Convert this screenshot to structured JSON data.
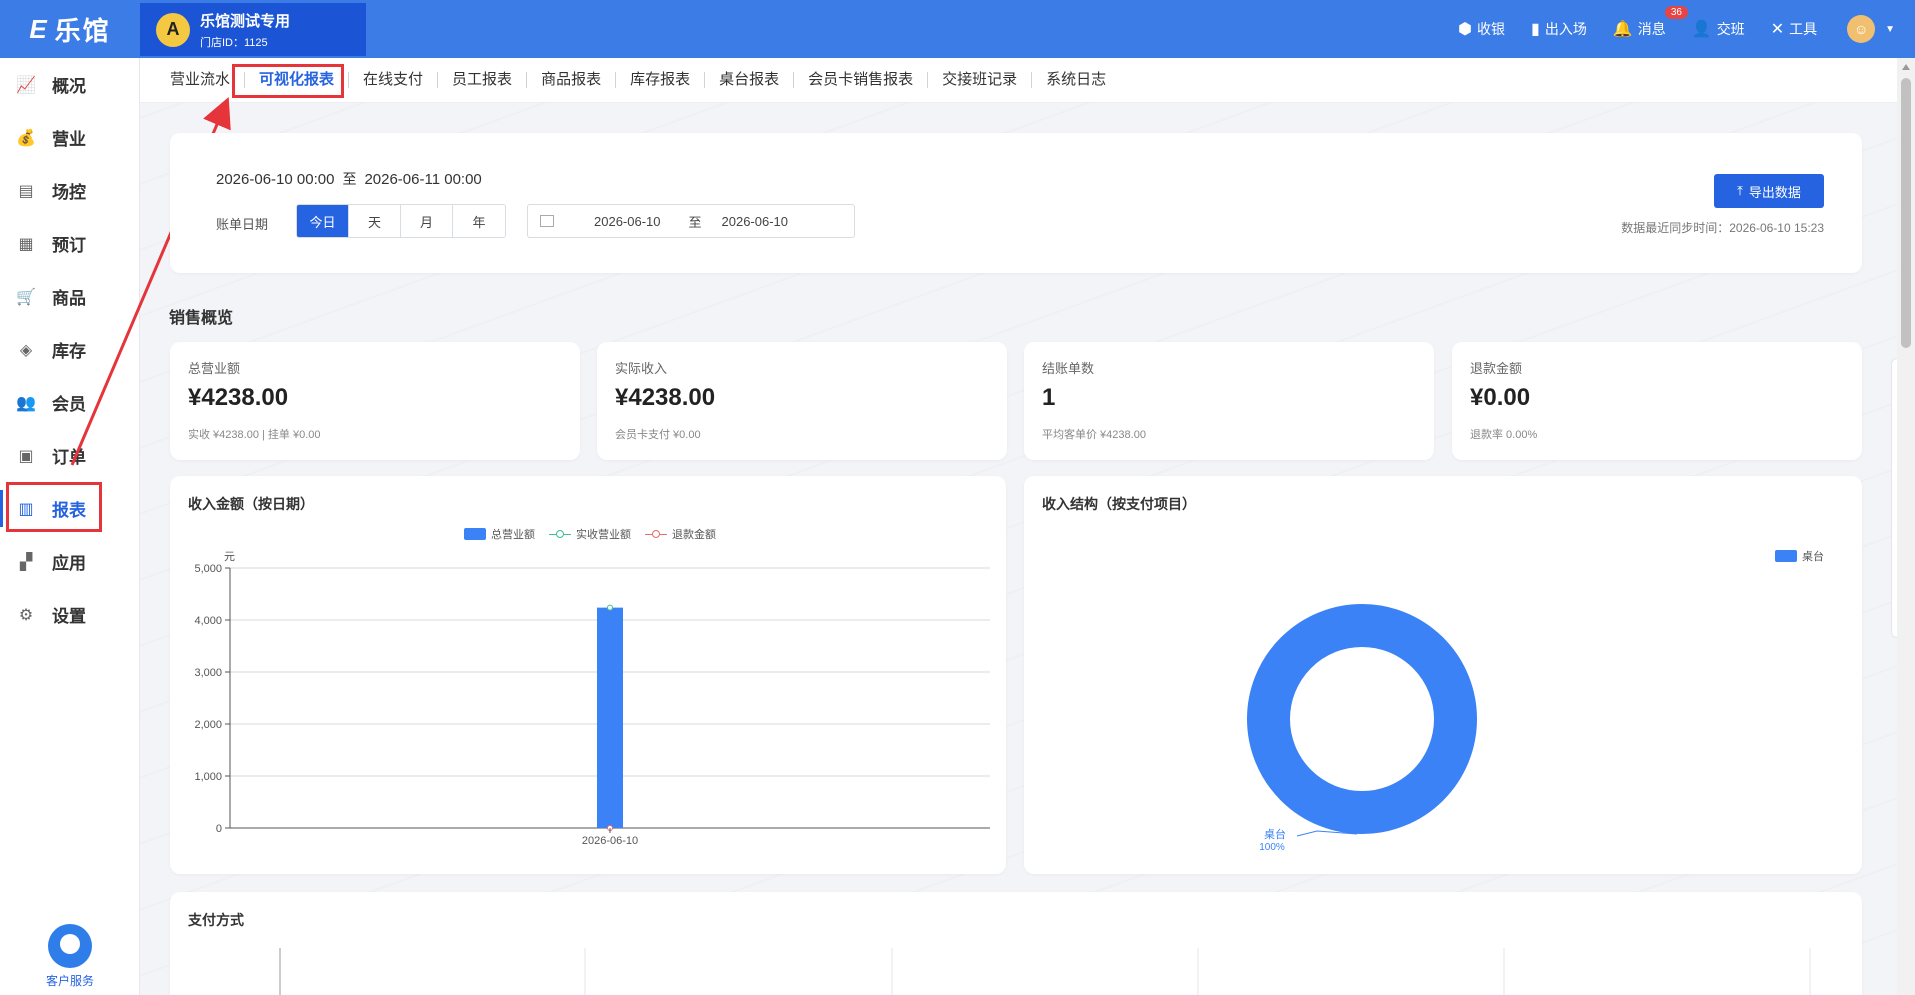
{
  "app": {
    "logo": "乐馆"
  },
  "store": {
    "name": "乐馆测试专用",
    "id_label": "门店ID：1125"
  },
  "topbar": {
    "actions": [
      {
        "label": "收银",
        "icon": "cash-register-icon"
      },
      {
        "label": "出入场",
        "icon": "door-icon"
      },
      {
        "label": "消息",
        "icon": "bell-icon",
        "badge": "36"
      },
      {
        "label": "交班",
        "icon": "user-swap-icon"
      },
      {
        "label": "工具",
        "icon": "tools-icon"
      }
    ]
  },
  "sidebar": {
    "items": [
      {
        "label": "概况",
        "icon": "trend-chart-icon"
      },
      {
        "label": "营业",
        "icon": "money-bag-icon"
      },
      {
        "label": "场控",
        "icon": "table-control-icon"
      },
      {
        "label": "预订",
        "icon": "calendar-icon"
      },
      {
        "label": "商品",
        "icon": "cart-icon"
      },
      {
        "label": "库存",
        "icon": "layers-icon"
      },
      {
        "label": "会员",
        "icon": "members-icon"
      },
      {
        "label": "订单",
        "icon": "order-icon"
      },
      {
        "label": "报表",
        "icon": "bar-chart-icon",
        "active": true
      },
      {
        "label": "应用",
        "icon": "apps-icon"
      },
      {
        "label": "设置",
        "icon": "gear-icon"
      }
    ],
    "service_label": "客户服务"
  },
  "tabs": [
    "营业流水",
    "可视化报表",
    "在线支付",
    "员工报表",
    "商品报表",
    "库存报表",
    "桌台报表",
    "会员卡销售报表",
    "交接班记录",
    "系统日志"
  ],
  "active_tab": "可视化报表",
  "filter": {
    "range_start": "2026-06-10 00:00",
    "range_sep": "至",
    "range_end": "2026-06-11 00:00",
    "bill_date_label": "账单日期",
    "periods": [
      "今日",
      "天",
      "月",
      "年"
    ],
    "active_period": "今日",
    "date_from": "2026-06-10",
    "date_sep": "至",
    "date_to": "2026-06-10",
    "export_label": "导出数据",
    "sync_text": "数据最近同步时间：2026-06-10 15:23"
  },
  "sales_overview": {
    "title": "销售概览",
    "cards": [
      {
        "label": "总营业额",
        "value": "¥4238.00",
        "sub": "实收 ¥4238.00 | 挂单 ¥0.00"
      },
      {
        "label": "实际收入",
        "value": "¥4238.00",
        "sub": "会员卡支付 ¥0.00"
      },
      {
        "label": "结账单数",
        "value": "1",
        "sub": "平均客单价 ¥4238.00"
      },
      {
        "label": "退款金额",
        "value": "¥0.00",
        "sub": "退款率 0.00%"
      }
    ]
  },
  "chart_data": [
    {
      "type": "bar",
      "title": "收入金额（按日期）",
      "ylabel": "元",
      "ylim": [
        0,
        5000
      ],
      "yticks": [
        "5,000",
        "4,000",
        "3,000",
        "2,000",
        "1,000",
        "0"
      ],
      "categories": [
        "2026-06-10"
      ],
      "series": [
        {
          "name": "总营业额",
          "kind": "bar",
          "values": [
            4238
          ],
          "color": "#3b82f6"
        },
        {
          "name": "实收营业额",
          "kind": "line",
          "values": [
            4238
          ],
          "color": "#3cc08c"
        },
        {
          "name": "退款金额",
          "kind": "line",
          "values": [
            0
          ],
          "color": "#e86a6a"
        }
      ],
      "grid": true,
      "legend": "top-center"
    },
    {
      "type": "pie",
      "title": "收入结构（按支付项目）",
      "slices": [
        {
          "name": "桌台",
          "value": 100,
          "label": "100%",
          "color": "#3b82f6"
        }
      ],
      "legend": "top-right"
    }
  ],
  "payment": {
    "title": "支付方式"
  }
}
